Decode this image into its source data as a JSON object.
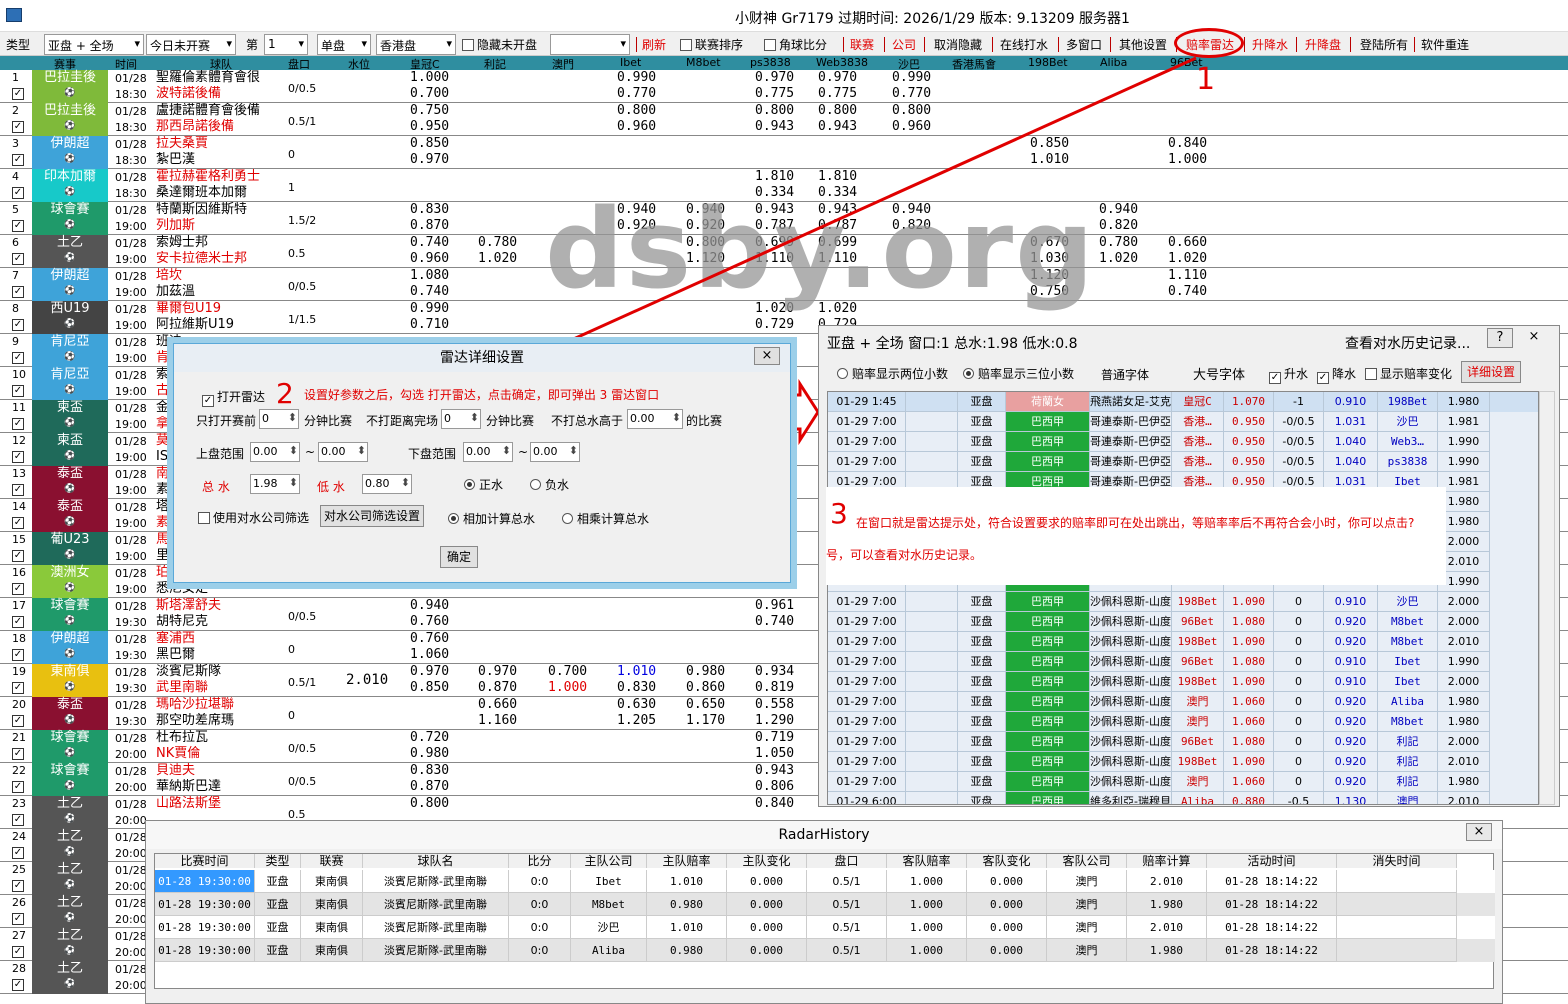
{
  "window": {
    "title": "小财神    Gr7179  过期时间: 2026/1/29  版本: 9.13209  服务器1"
  },
  "toolbar": {
    "type_label": "类型",
    "type_value": "亚盘 + 全场",
    "day_value": "今日未开赛",
    "di_label": "第",
    "di_value": "1",
    "single_value": "单盘",
    "hk_value": "香港盘",
    "hide_unstarted": "隐藏未开盘",
    "refresh": "刷新",
    "league_sort": "联赛排序",
    "corner": "角球比分",
    "league": "联赛",
    "company": "公司",
    "cancel_hide": "取消隐藏",
    "online": "在线打水",
    "multi": "多窗口",
    "other": "其他设置",
    "radar": "赔率雷达",
    "rise": "升降水",
    "rise_pan": "升降盘",
    "login_all": "登陆所有",
    "restart": "软件重连"
  },
  "grid_header": [
    "赛事",
    "时间",
    "球队",
    "盘口",
    "水位",
    "皇冠C",
    "利記",
    "澳門",
    "Ibet",
    "M8bet",
    "ps3838",
    "Web3838",
    "沙巴",
    "香港馬會",
    "198Bet",
    "Aliba",
    "96Bet"
  ],
  "rows": [
    {
      "n": "1",
      "league": "巴拉圭後",
      "lc": "#7fba3a",
      "date": "01/28",
      "time": "18:30",
      "home": "聖羅倫素體育會很",
      "away": "波特諾後備",
      "hr": false,
      "ar": true,
      "hcap": "0/0.5",
      "o": [
        [
          "1.000",
          "0.700",
          410
        ],
        [
          "0.990",
          "0.770",
          617
        ],
        [
          "0.970",
          "0.775",
          755
        ],
        [
          "0.970",
          "0.775",
          818
        ],
        [
          "0.990",
          "0.770",
          892
        ]
      ]
    },
    {
      "n": "2",
      "league": "巴拉圭後",
      "lc": "#7fba3a",
      "date": "01/28",
      "time": "18:30",
      "home": "盧捷諾體育會後備",
      "away": "那西昂諾後備",
      "hr": false,
      "ar": true,
      "hcap": "0.5/1",
      "o": [
        [
          "0.750",
          "0.950",
          410
        ],
        [
          "0.800",
          "0.960",
          617
        ],
        [
          "0.800",
          "0.943",
          755
        ],
        [
          "0.800",
          "0.943",
          818
        ],
        [
          "0.800",
          "0.960",
          892
        ]
      ]
    },
    {
      "n": "3",
      "league": "伊朗超",
      "lc": "#3ea3d9",
      "date": "01/28",
      "time": "18:30",
      "home": "拉夫桑賈",
      "away": "紮巴漢",
      "hr": true,
      "ar": false,
      "hcap": "0",
      "o": [
        [
          "0.850",
          "0.970",
          410
        ],
        [
          "0.850",
          "1.010",
          1030
        ],
        [
          "0.840",
          "1.000",
          1168
        ]
      ]
    },
    {
      "n": "4",
      "league": "印本加爾",
      "lc": "#17c9c9",
      "date": "01/28",
      "time": "18:30",
      "home": "霍拉赫霍格利勇士",
      "away": "桑達爾班本加爾",
      "hr": true,
      "ar": false,
      "hcap": "1",
      "o": [
        [
          "1.810",
          "0.334",
          755
        ],
        [
          "1.810",
          "0.334",
          818
        ]
      ]
    },
    {
      "n": "5",
      "league": "球會賽",
      "lc": "#1f9a6a",
      "date": "01/28",
      "time": "19:00",
      "home": "特蘭斯因維斯特",
      "away": "列加斯",
      "hr": false,
      "ar": true,
      "hcap": "1.5/2",
      "o": [
        [
          "0.830",
          "0.870",
          410
        ],
        [
          "0.940",
          "0.920",
          617
        ],
        [
          "0.940",
          "0.920",
          686
        ],
        [
          "0.943",
          "0.787",
          755
        ],
        [
          "0.943",
          "0.787",
          818
        ],
        [
          "0.940",
          "0.820",
          892
        ],
        [
          "0.940",
          "0.820",
          1099
        ]
      ]
    },
    {
      "n": "6",
      "league": "土乙",
      "lc": "#555555",
      "date": "01/28",
      "time": "19:00",
      "home": "索姆士邦",
      "away": "安卡拉德米士邦",
      "hr": false,
      "ar": true,
      "hcap": "0.5",
      "o": [
        [
          "0.740",
          "0.960",
          410
        ],
        [
          "0.780",
          "1.020",
          478
        ],
        [
          "0.800",
          "1.120",
          686
        ],
        [
          "0.699",
          "1.110",
          755
        ],
        [
          "0.699",
          "1.110",
          818
        ],
        [
          "0.670",
          "1.030",
          1030
        ],
        [
          "0.780",
          "1.020",
          1099
        ],
        [
          "0.660",
          "1.020",
          1168
        ]
      ]
    },
    {
      "n": "7",
      "league": "伊朗超",
      "lc": "#3ea3d9",
      "date": "01/28",
      "time": "19:00",
      "home": "培坎",
      "away": "加茲溫",
      "hr": true,
      "ar": false,
      "hcap": "0/0.5",
      "o": [
        [
          "1.080",
          "0.740",
          410
        ],
        [
          "1.120",
          "0.750",
          1030
        ],
        [
          "1.110",
          "0.740",
          1168
        ]
      ]
    },
    {
      "n": "8",
      "league": "西U19",
      "lc": "#444444",
      "date": "01/28",
      "time": "19:00",
      "home": "畢爾包U19",
      "away": "阿拉維斯U19",
      "hr": true,
      "ar": false,
      "hcap": "1/1.5",
      "o": [
        [
          "0.990",
          "0.710",
          410
        ],
        [
          "1.020",
          "0.729",
          755
        ],
        [
          "1.020",
          "0.729",
          818
        ]
      ]
    },
    {
      "n": "9",
      "league": "肯尼亞",
      "lc": "#3ea3d9",
      "date": "01/28",
      "time": "19:00",
      "home": "班迪",
      "away": "肯尼",
      "hr": false,
      "ar": true,
      "hcap": "",
      "o": []
    },
    {
      "n": "10",
      "league": "肯尼亞",
      "lc": "#3ea3d9",
      "date": "01/28",
      "time": "19:00",
      "home": "索佩",
      "away": "古吉",
      "hr": false,
      "ar": true,
      "hcap": "",
      "o": []
    },
    {
      "n": "11",
      "league": "柬盃",
      "lc": "#1f6a5a",
      "date": "01/28",
      "time": "19:00",
      "home": "金邊",
      "away": "拿加",
      "hr": false,
      "ar": true,
      "hcap": "",
      "o": []
    },
    {
      "n": "12",
      "league": "柬盃",
      "lc": "#1f6a5a",
      "date": "01/28",
      "time": "19:00",
      "home": "莫德",
      "away": "ISI",
      "hr": true,
      "ar": false,
      "hcap": "",
      "o": []
    },
    {
      "n": "13",
      "league": "泰盃",
      "lc": "#8a1030",
      "date": "01/28",
      "time": "19:00",
      "home": "南邦",
      "away": "素可",
      "hr": true,
      "ar": false,
      "hcap": "",
      "o": []
    },
    {
      "n": "14",
      "league": "泰盃",
      "lc": "#8a1030",
      "date": "01/28",
      "time": "19:00",
      "home": "塔加",
      "away": "素可",
      "hr": false,
      "ar": true,
      "hcap": "",
      "o": []
    },
    {
      "n": "15",
      "league": "葡U23",
      "lc": "#1f6a5a",
      "date": "01/28",
      "time": "19:00",
      "home": "馬里",
      "away": "里奧",
      "hr": true,
      "ar": false,
      "hcap": "",
      "o": []
    },
    {
      "n": "16",
      "league": "澳洲女",
      "lc": "#8ac93a",
      "date": "01/28",
      "time": "19:00",
      "home": "珀斯",
      "away": "悉尼女足",
      "hr": true,
      "ar": false,
      "hcap": "",
      "o": [
        [
          "0.810",
          null,
          410
        ],
        [
          "0.770",
          null,
          478
        ],
        [
          "0.650",
          null,
          548
        ],
        [
          "0.840",
          null,
          617
        ],
        [
          "0.810",
          null,
          686
        ],
        [
          "0.769",
          null,
          755
        ]
      ]
    },
    {
      "n": "17",
      "league": "球會賽",
      "lc": "#1f9a6a",
      "date": "01/28",
      "time": "19:30",
      "home": "斯塔澤舒夫",
      "away": "胡特尼克",
      "hr": true,
      "ar": false,
      "hcap": "0/0.5",
      "o": [
        [
          "0.940",
          "0.760",
          410
        ],
        [
          "0.961",
          "0.740",
          755
        ]
      ]
    },
    {
      "n": "18",
      "league": "伊朗超",
      "lc": "#3ea3d9",
      "date": "01/28",
      "time": "19:30",
      "home": "塞浦西",
      "away": "黑巴爾",
      "hr": true,
      "ar": false,
      "hcap": "0",
      "o": [
        [
          "0.760",
          "1.060",
          410
        ]
      ]
    },
    {
      "n": "19",
      "league": "東南俱",
      "lc": "#e8c010",
      "date": "01/28",
      "time": "19:30",
      "home": "淡賓尼斯隊",
      "away": "武里南聯",
      "hr": false,
      "ar": true,
      "hcap": "0.5/1",
      "o": [
        [
          "0.970",
          "0.850",
          410
        ],
        [
          "0.970",
          "0.870",
          478
        ],
        [
          "0.700",
          "1.000",
          548
        ],
        [
          "1.010",
          "0.830",
          617
        ],
        [
          "0.980",
          "0.860",
          686
        ],
        [
          "0.934",
          "0.819",
          755
        ]
      ],
      "water": "2.010"
    },
    {
      "n": "20",
      "league": "泰盃",
      "lc": "#8a1030",
      "date": "01/28",
      "time": "19:30",
      "home": "瑪哈沙拉堪聯",
      "away": "那空叻差席瑪",
      "hr": true,
      "ar": false,
      "hcap": "0",
      "o": [
        [
          "0.660",
          "1.160",
          478
        ],
        [
          "0.630",
          "1.205",
          617
        ],
        [
          "0.650",
          "1.170",
          686
        ],
        [
          "0.558",
          "1.290",
          755
        ]
      ]
    },
    {
      "n": "21",
      "league": "球會賽",
      "lc": "#1f9a6a",
      "date": "01/28",
      "time": "20:00",
      "home": "杜布拉瓦",
      "away": "NK賈倫",
      "hr": false,
      "ar": true,
      "hcap": "0/0.5",
      "o": [
        [
          "0.720",
          "0.980",
          410
        ],
        [
          "0.719",
          "1.050",
          755
        ]
      ]
    },
    {
      "n": "22",
      "league": "球會賽",
      "lc": "#1f9a6a",
      "date": "01/28",
      "time": "20:00",
      "home": "貝迪夫",
      "away": "華納斯巴達",
      "hr": true,
      "ar": false,
      "hcap": "0/0.5",
      "o": [
        [
          "0.830",
          "0.870",
          410
        ],
        [
          "0.943",
          "0.806",
          755
        ]
      ]
    },
    {
      "n": "23",
      "league": "土乙",
      "lc": "#555555",
      "date": "01/28",
      "time": "20:00",
      "home": "山路法斯堡",
      "away": "",
      "hr": true,
      "ar": false,
      "hcap": "0.5",
      "o": [
        [
          "0.800",
          null,
          410
        ],
        [
          "0.840",
          null,
          755
        ]
      ]
    },
    {
      "n": "24",
      "league": "土乙",
      "lc": "#555555",
      "date": "01/28",
      "time": "20:00",
      "home": "",
      "away": "",
      "hr": false,
      "ar": false,
      "hcap": "",
      "o": []
    },
    {
      "n": "25",
      "league": "土乙",
      "lc": "#555555",
      "date": "01/28",
      "time": "20:00",
      "home": "",
      "away": "",
      "hr": false,
      "ar": false,
      "hcap": "",
      "o": []
    },
    {
      "n": "26",
      "league": "土乙",
      "lc": "#555555",
      "date": "01/28",
      "time": "20:00",
      "home": "",
      "away": "",
      "hr": false,
      "ar": false,
      "hcap": "",
      "o": []
    },
    {
      "n": "27",
      "league": "土乙",
      "lc": "#555555",
      "date": "01/28",
      "time": "20:00",
      "home": "",
      "away": "",
      "hr": false,
      "ar": false,
      "hcap": "",
      "o": []
    },
    {
      "n": "28",
      "league": "土乙",
      "lc": "#555555",
      "date": "01/28",
      "time": "20:00",
      "home": "",
      "away": "",
      "hr": false,
      "ar": false,
      "hcap": "",
      "o": []
    }
  ],
  "watermark": "dsby.org",
  "annotations": {
    "one": "1",
    "two": "2",
    "two_text": "设置好参数之后，勾选 打开雷达，点击确定，即可弹出 3 雷达窗口",
    "three": "3",
    "three_text": "在窗口就是雷达提示处，符合设置要求的赔率即可在处出跳出，等赔率率后不再符合会小时，你可以点击?",
    "three_text2": "号，可以查看对水历史记录。"
  },
  "radar": {
    "title": "雷达详细设置",
    "close": "×",
    "open": "打开雷达",
    "only_before": "只打开赛前",
    "min_label": "分钟比赛",
    "v_before": "0",
    "not_far": "不打距离完场",
    "v_far": "0",
    "min_label2": "分钟比赛",
    "not_total": "不打总水高于",
    "v_total": "0.00",
    "race": "的比赛",
    "up_range": "上盘范围",
    "up1": "0.00",
    "tilde": "~",
    "up2": "0.00",
    "down_range": "下盘范围",
    "dn1": "0.00",
    "dn2": "0.00",
    "total_water": "总 水",
    "v_tw": "1.98",
    "low_water": "低 水",
    "v_lw": "0.80",
    "pos": "正水",
    "neg": "负水",
    "use_company": "使用对水公司筛选",
    "company_btn": "对水公司筛选设置",
    "add_calc": "相加计算总水",
    "mul_calc": "相乘计算总水",
    "ok": "确定"
  },
  "hist": {
    "title": "亚盘 + 全场    窗口:1   总水:1.98 低水:0.8",
    "view": "查看对水历史记录...",
    "q": "?",
    "x": "×",
    "two_dec": "赔率显示两位小数",
    "three_dec": "赔率显示三位小数",
    "normal_font": "普通字体",
    "big_font": "大号字体",
    "rise": "升水",
    "fall": "降水",
    "show_change": "显示赔率变化",
    "detail": "详细设置",
    "rows": [
      [
        "01-29 1:45",
        "亚盘",
        "荷蘭女",
        "飛燕諾女足-艾克馬亞女足",
        "皇冠C",
        "1.070",
        "-1",
        "0.910",
        "198Bet",
        "1.980",
        "pink"
      ],
      [
        "01-29 7:00",
        "亚盘",
        "巴西甲",
        "哥連泰斯-巴伊亞",
        "香港…",
        "0.950",
        "-0/0.5",
        "1.031",
        "沙巴",
        "1.981",
        "green"
      ],
      [
        "01-29 7:00",
        "亚盘",
        "巴西甲",
        "哥連泰斯-巴伊亞",
        "香港…",
        "0.950",
        "-0/0.5",
        "1.040",
        "Web3…",
        "1.990",
        "green"
      ],
      [
        "01-29 7:00",
        "亚盘",
        "巴西甲",
        "哥連泰斯-巴伊亞",
        "香港…",
        "0.950",
        "-0/0.5",
        "1.040",
        "ps3838",
        "1.990",
        "green"
      ],
      [
        "01-29 7:00",
        "亚盘",
        "巴西甲",
        "哥連泰斯-巴伊亞",
        "香港…",
        "0.950",
        "-0/0.5",
        "1.031",
        "Ibet",
        "1.981",
        "green"
      ],
      [
        "",
        "",
        "",
        "",
        "",
        "",
        "",
        "",
        "…",
        "1.980",
        "green"
      ],
      [
        "",
        "",
        "",
        "",
        "",
        "",
        "",
        "",
        "38",
        "1.980",
        "green"
      ],
      [
        "",
        "",
        "",
        "",
        "",
        "",
        "",
        "",
        "a",
        "2.000",
        "green"
      ],
      [
        "",
        "",
        "",
        "",
        "",
        "",
        "",
        "",
        "a",
        "2.010",
        "green"
      ],
      [
        "",
        "",
        "",
        "",
        "",
        "",
        "",
        "",
        "",
        "1.990",
        "green"
      ],
      [
        "01-29 7:00",
        "亚盘",
        "巴西甲",
        "沙佩科恩斯-山度士",
        "198Bet",
        "1.090",
        "0",
        "0.910",
        "沙巴",
        "2.000",
        "green"
      ],
      [
        "01-29 7:00",
        "亚盘",
        "巴西甲",
        "沙佩科恩斯-山度士",
        "96Bet",
        "1.080",
        "0",
        "0.920",
        "M8bet",
        "2.000",
        "green"
      ],
      [
        "01-29 7:00",
        "亚盘",
        "巴西甲",
        "沙佩科恩斯-山度士",
        "198Bet",
        "1.090",
        "0",
        "0.920",
        "M8bet",
        "2.010",
        "green"
      ],
      [
        "01-29 7:00",
        "亚盘",
        "巴西甲",
        "沙佩科恩斯-山度士",
        "96Bet",
        "1.080",
        "0",
        "0.910",
        "Ibet",
        "1.990",
        "green"
      ],
      [
        "01-29 7:00",
        "亚盘",
        "巴西甲",
        "沙佩科恩斯-山度士",
        "198Bet",
        "1.090",
        "0",
        "0.910",
        "Ibet",
        "2.000",
        "green"
      ],
      [
        "01-29 7:00",
        "亚盘",
        "巴西甲",
        "沙佩科恩斯-山度士",
        "澳門",
        "1.060",
        "0",
        "0.920",
        "Aliba",
        "1.980",
        "green"
      ],
      [
        "01-29 7:00",
        "亚盘",
        "巴西甲",
        "沙佩科恩斯-山度士",
        "澳門",
        "1.060",
        "0",
        "0.920",
        "M8bet",
        "1.980",
        "green"
      ],
      [
        "01-29 7:00",
        "亚盘",
        "巴西甲",
        "沙佩科恩斯-山度士",
        "96Bet",
        "1.080",
        "0",
        "0.920",
        "利記",
        "2.000",
        "green"
      ],
      [
        "01-29 7:00",
        "亚盘",
        "巴西甲",
        "沙佩科恩斯-山度士",
        "198Bet",
        "1.090",
        "0",
        "0.920",
        "利記",
        "2.010",
        "green"
      ],
      [
        "01-29 7:00",
        "亚盘",
        "巴西甲",
        "沙佩科恩斯-山度士",
        "澳門",
        "1.060",
        "0",
        "0.920",
        "利記",
        "1.980",
        "green"
      ],
      [
        "01-29 6:00",
        "亚盘",
        "巴西甲",
        "維多利亞-瑞穆貝雷",
        "Aliba",
        "0.880",
        "-0.5",
        "1.130",
        "澳門",
        "2.010",
        "green"
      ]
    ]
  },
  "rh": {
    "title": "RadarHistory",
    "close": "×",
    "headers": [
      "比赛时间",
      "类型",
      "联赛",
      "球队名",
      "比分",
      "主队公司",
      "主队赔率",
      "主队变化",
      "盘口",
      "客队赔率",
      "客队变化",
      "客队公司",
      "赔率计算",
      "活动时间",
      "消失时间"
    ],
    "rows": [
      [
        "01-28 19:30:00",
        "亚盘",
        "東南俱",
        "淡賓尼斯隊-武里南聯",
        "0:0",
        "Ibet",
        "1.010",
        "0.000",
        "0.5/1",
        "1.000",
        "0.000",
        "澳門",
        "2.010",
        "01-28 18:14:22",
        ""
      ],
      [
        "01-28 19:30:00",
        "亚盘",
        "東南俱",
        "淡賓尼斯隊-武里南聯",
        "0:0",
        "M8bet",
        "0.980",
        "0.000",
        "0.5/1",
        "1.000",
        "0.000",
        "澳門",
        "1.980",
        "01-28 18:14:22",
        ""
      ],
      [
        "01-28 19:30:00",
        "亚盘",
        "東南俱",
        "淡賓尼斯隊-武里南聯",
        "0:0",
        "沙巴",
        "1.010",
        "0.000",
        "0.5/1",
        "1.000",
        "0.000",
        "澳門",
        "2.010",
        "01-28 18:14:22",
        ""
      ],
      [
        "01-28 19:30:00",
        "亚盘",
        "東南俱",
        "淡賓尼斯隊-武里南聯",
        "0:0",
        "Aliba",
        "0.980",
        "0.000",
        "0.5/1",
        "1.000",
        "0.000",
        "澳門",
        "1.980",
        "01-28 18:14:22",
        ""
      ]
    ]
  }
}
